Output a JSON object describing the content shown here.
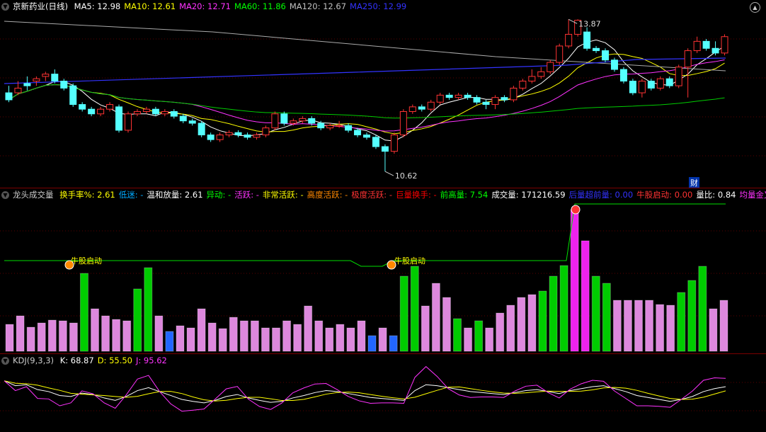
{
  "main": {
    "title": "京新药业(日线)",
    "ma": [
      {
        "label": "MA5: 12.98",
        "color": "#ffffff"
      },
      {
        "label": "MA10: 12.61",
        "color": "#ffff00"
      },
      {
        "label": "MA20: 12.71",
        "color": "#ff33ff"
      },
      {
        "label": "MA60: 11.86",
        "color": "#00ff00"
      },
      {
        "label": "MA120: 12.67",
        "color": "#c0c0c0"
      },
      {
        "label": "MA250: 12.99",
        "color": "#3333ff"
      }
    ],
    "high_label": "13.87",
    "low_label": "10.62",
    "fin_badge": "财"
  },
  "volume": {
    "title": "龙头成交量",
    "items": [
      {
        "label": "换手率%: 2.61",
        "color": "#ffff00"
      },
      {
        "label": "低迷: -",
        "color": "#00aaff"
      },
      {
        "label": "温和放量: 2.61",
        "color": "#ffffff"
      },
      {
        "label": "异动: -",
        "color": "#00ff00"
      },
      {
        "label": "活跃: -",
        "color": "#ff33ff"
      },
      {
        "label": "非常活跃: -",
        "color": "#ffff00"
      },
      {
        "label": "高度活跃: -",
        "color": "#ff8800"
      },
      {
        "label": "极度活跃: -",
        "color": "#ff3333"
      },
      {
        "label": "巨量换手: -",
        "color": "#ff0000"
      },
      {
        "label": "前高量: 7.54",
        "color": "#00ff00"
      },
      {
        "label": "成交量: 171216.59",
        "color": "#ffffff"
      },
      {
        "label": "后量超前量: 0.00",
        "color": "#3333ff"
      },
      {
        "label": "牛股启动: 0.00",
        "color": "#ff3333"
      },
      {
        "label": "量比: 0.84",
        "color": "#ffffff"
      },
      {
        "label": "均量金叉",
        "color": "#ff33ff"
      }
    ],
    "signal_label": "牛股启动"
  },
  "kdj": {
    "title": "KDJ(9,3,3)",
    "items": [
      {
        "label": "K: 68.87",
        "color": "#ffffff"
      },
      {
        "label": "D: 55.50",
        "color": "#ffff00"
      },
      {
        "label": "J: 95.62",
        "color": "#ff33ff"
      }
    ]
  },
  "colors": {
    "up": "#ff3333",
    "down": "#54ffff",
    "bg": "#000000",
    "grid": "#7a0000"
  },
  "chart_data": {
    "type": "candlestick",
    "low": 10.62,
    "high": 13.87,
    "candles": [
      [
        12.3,
        12.15,
        12.45,
        12.1
      ],
      [
        12.3,
        12.4,
        12.55,
        12.25
      ],
      [
        12.5,
        12.45,
        12.65,
        12.35
      ],
      [
        12.55,
        12.6,
        12.65,
        12.45
      ],
      [
        12.65,
        12.7,
        12.75,
        12.55
      ],
      [
        12.7,
        12.55,
        12.8,
        12.5
      ],
      [
        12.55,
        12.4,
        12.6,
        12.35
      ],
      [
        12.45,
        12.05,
        12.5,
        12.0
      ],
      [
        12.05,
        11.95,
        12.1,
        11.9
      ],
      [
        11.95,
        11.85,
        12.0,
        11.8
      ],
      [
        11.85,
        11.95,
        12.0,
        11.8
      ],
      [
        11.95,
        12.05,
        12.1,
        11.9
      ],
      [
        12.0,
        11.5,
        12.05,
        11.45
      ],
      [
        11.5,
        11.85,
        11.9,
        11.45
      ],
      [
        11.85,
        11.9,
        11.95,
        11.8
      ],
      [
        11.9,
        11.95,
        12.0,
        11.85
      ],
      [
        11.95,
        11.85,
        12.0,
        11.8
      ],
      [
        11.85,
        11.9,
        11.95,
        11.8
      ],
      [
        11.9,
        11.8,
        11.95,
        11.75
      ],
      [
        11.8,
        11.7,
        11.85,
        11.65
      ],
      [
        11.7,
        11.65,
        11.75,
        11.6
      ],
      [
        11.65,
        11.4,
        11.7,
        11.35
      ],
      [
        11.4,
        11.3,
        11.45,
        11.25
      ],
      [
        11.3,
        11.4,
        11.45,
        11.25
      ],
      [
        11.4,
        11.45,
        11.5,
        11.35
      ],
      [
        11.45,
        11.4,
        11.5,
        11.35
      ],
      [
        11.4,
        11.35,
        11.45,
        11.3
      ],
      [
        11.35,
        11.4,
        11.45,
        11.3
      ],
      [
        11.4,
        11.55,
        11.6,
        11.35
      ],
      [
        11.55,
        11.85,
        11.9,
        11.5
      ],
      [
        11.85,
        11.65,
        11.9,
        11.6
      ],
      [
        11.65,
        11.7,
        11.75,
        11.6
      ],
      [
        11.7,
        11.75,
        11.8,
        11.65
      ],
      [
        11.75,
        11.65,
        11.8,
        11.6
      ],
      [
        11.65,
        11.55,
        11.7,
        11.5
      ],
      [
        11.55,
        11.6,
        11.65,
        11.5
      ],
      [
        11.6,
        11.6,
        11.7,
        11.55
      ],
      [
        11.6,
        11.5,
        11.65,
        11.45
      ],
      [
        11.5,
        11.4,
        11.55,
        11.35
      ],
      [
        11.4,
        11.35,
        11.45,
        11.3
      ],
      [
        11.35,
        11.15,
        11.4,
        11.1
      ],
      [
        11.15,
        11.05,
        11.2,
        10.62
      ],
      [
        11.05,
        11.4,
        11.45,
        11.0
      ],
      [
        11.4,
        11.9,
        11.95,
        11.35
      ],
      [
        11.9,
        12.0,
        12.05,
        11.85
      ],
      [
        12.0,
        11.95,
        12.05,
        11.9
      ],
      [
        11.95,
        12.1,
        12.15,
        11.9
      ],
      [
        12.1,
        12.25,
        12.3,
        12.05
      ],
      [
        12.25,
        12.2,
        12.3,
        12.15
      ],
      [
        12.2,
        12.25,
        12.3,
        12.15
      ],
      [
        12.25,
        12.2,
        12.3,
        12.15
      ],
      [
        12.2,
        12.1,
        12.25,
        12.05
      ],
      [
        12.1,
        12.05,
        12.15,
        11.95
      ],
      [
        12.05,
        12.2,
        12.25,
        11.95
      ],
      [
        12.2,
        12.15,
        12.25,
        12.1
      ],
      [
        12.15,
        12.4,
        12.45,
        12.1
      ],
      [
        12.4,
        12.55,
        12.6,
        12.35
      ],
      [
        12.55,
        12.65,
        12.8,
        12.5
      ],
      [
        12.65,
        12.75,
        12.85,
        12.6
      ],
      [
        12.75,
        12.95,
        13.0,
        12.7
      ],
      [
        12.95,
        13.3,
        13.35,
        12.9
      ],
      [
        13.3,
        13.55,
        13.87,
        13.25
      ],
      [
        13.55,
        13.85,
        13.87,
        13.5
      ],
      [
        13.6,
        13.25,
        13.7,
        13.2
      ],
      [
        13.25,
        13.2,
        13.3,
        13.15
      ],
      [
        13.2,
        13.0,
        13.25,
        12.95
      ],
      [
        13.0,
        12.8,
        13.05,
        12.75
      ],
      [
        12.8,
        12.55,
        12.85,
        12.5
      ],
      [
        12.55,
        12.3,
        12.6,
        12.25
      ],
      [
        12.3,
        12.55,
        12.6,
        12.2
      ],
      [
        12.55,
        12.4,
        12.6,
        12.35
      ],
      [
        12.4,
        12.6,
        12.65,
        12.35
      ],
      [
        12.6,
        12.45,
        12.65,
        12.4
      ],
      [
        12.45,
        12.85,
        12.9,
        12.4
      ],
      [
        12.85,
        13.2,
        13.25,
        12.2
      ],
      [
        13.2,
        13.4,
        13.5,
        13.15
      ],
      [
        13.4,
        13.25,
        13.45,
        13.2
      ],
      [
        13.25,
        13.15,
        13.4,
        13.1
      ],
      [
        13.15,
        13.5,
        13.55,
        13.1
      ]
    ]
  }
}
